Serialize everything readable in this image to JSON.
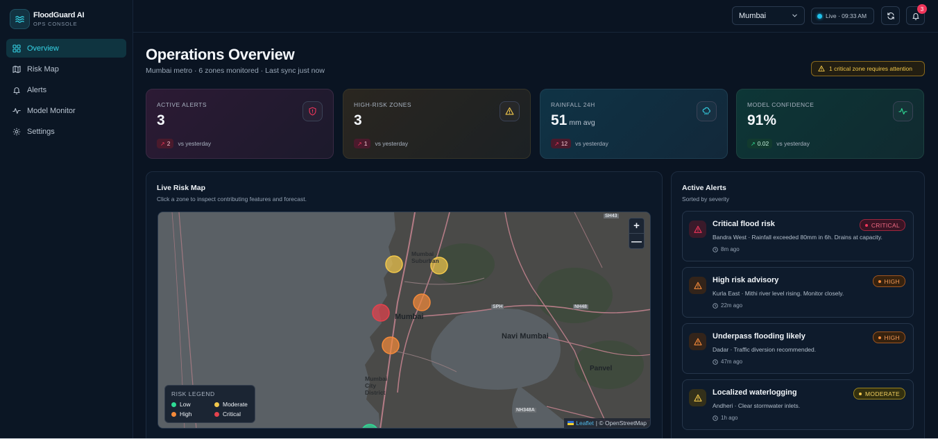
{
  "brand": {
    "name": "FloodGuard AI",
    "subtitle": "OPS CONSOLE"
  },
  "nav": {
    "items": [
      {
        "label": "Overview",
        "icon": "grid-icon",
        "active": true
      },
      {
        "label": "Risk Map",
        "icon": "map-icon",
        "active": false
      },
      {
        "label": "Alerts",
        "icon": "bell-icon",
        "active": false
      },
      {
        "label": "Model Monitor",
        "icon": "activity-icon",
        "active": false
      },
      {
        "label": "Settings",
        "icon": "gear-icon",
        "active": false
      }
    ]
  },
  "topbar": {
    "city": "Mumbai",
    "live_status": "Live · 09:33 AM",
    "notification_count": "3"
  },
  "page": {
    "title": "Operations Overview",
    "subtitle": "Mumbai metro · 6 zones monitored · Last sync just now",
    "attention": "1 critical zone requires attention"
  },
  "kpis": [
    {
      "label": "ACTIVE ALERTS",
      "value": "3",
      "unit": "",
      "delta": "2",
      "delta_note": "vs yesterday",
      "icon": "shield-alert-icon",
      "accent": "#f0355a"
    },
    {
      "label": "HIGH-RISK ZONES",
      "value": "3",
      "unit": "",
      "delta": "1",
      "delta_note": "vs yesterday",
      "icon": "warning-icon",
      "accent": "#f2c84b"
    },
    {
      "label": "RAINFALL 24H",
      "value": "51",
      "unit": "mm avg",
      "delta": "12",
      "delta_note": "vs yesterday",
      "icon": "cloud-rain-icon",
      "accent": "#35d3e6"
    },
    {
      "label": "MODEL CONFIDENCE",
      "value": "91%",
      "unit": "",
      "delta": "0.02",
      "delta_note": "vs yesterday",
      "icon": "pulse-icon",
      "accent": "#2edb95"
    }
  ],
  "map": {
    "title": "Live Risk Map",
    "subtitle": "Click a zone to inspect contributing features and forecast.",
    "labels": {
      "mumbai": "Mumbai",
      "navi_mumbai": "Navi Mumbai",
      "panvel": "Panvel",
      "mumbai_suburban": "Mumbai Suburban",
      "mumbai_city": "Mumbai City District",
      "sh43": "SH43",
      "nh48": "NH48",
      "sph": "SPH",
      "nh348a": "NH348A"
    },
    "zoom_in": "+",
    "zoom_out": "—",
    "legend": {
      "title": "RISK LEGEND",
      "items": [
        {
          "label": "Low",
          "color": "#2edb95"
        },
        {
          "label": "Moderate",
          "color": "#f2c84b"
        },
        {
          "label": "High",
          "color": "#f58a3a"
        },
        {
          "label": "Critical",
          "color": "#e5424d"
        }
      ]
    },
    "attribution_leaflet": "Leaflet",
    "attribution_osm": "| © OpenStreetMap"
  },
  "alerts": {
    "title": "Active Alerts",
    "subtitle": "Sorted by severity",
    "items": [
      {
        "title": "Critical flood risk",
        "desc": "Bandra West · Rainfall exceeded 80mm in 6h. Drains at capacity.",
        "time": "8m ago",
        "severity": "CRITICAL",
        "color": "#f0355a"
      },
      {
        "title": "High risk advisory",
        "desc": "Kurla East · Mithi river level rising. Monitor closely.",
        "time": "22m ago",
        "severity": "HIGH",
        "color": "#f58a3a"
      },
      {
        "title": "Underpass flooding likely",
        "desc": "Dadar · Traffic diversion recommended.",
        "time": "47m ago",
        "severity": "HIGH",
        "color": "#f58a3a"
      },
      {
        "title": "Localized waterlogging",
        "desc": "Andheri · Clear stormwater inlets.",
        "time": "1h ago",
        "severity": "MODERATE",
        "color": "#f2c84b"
      }
    ]
  }
}
